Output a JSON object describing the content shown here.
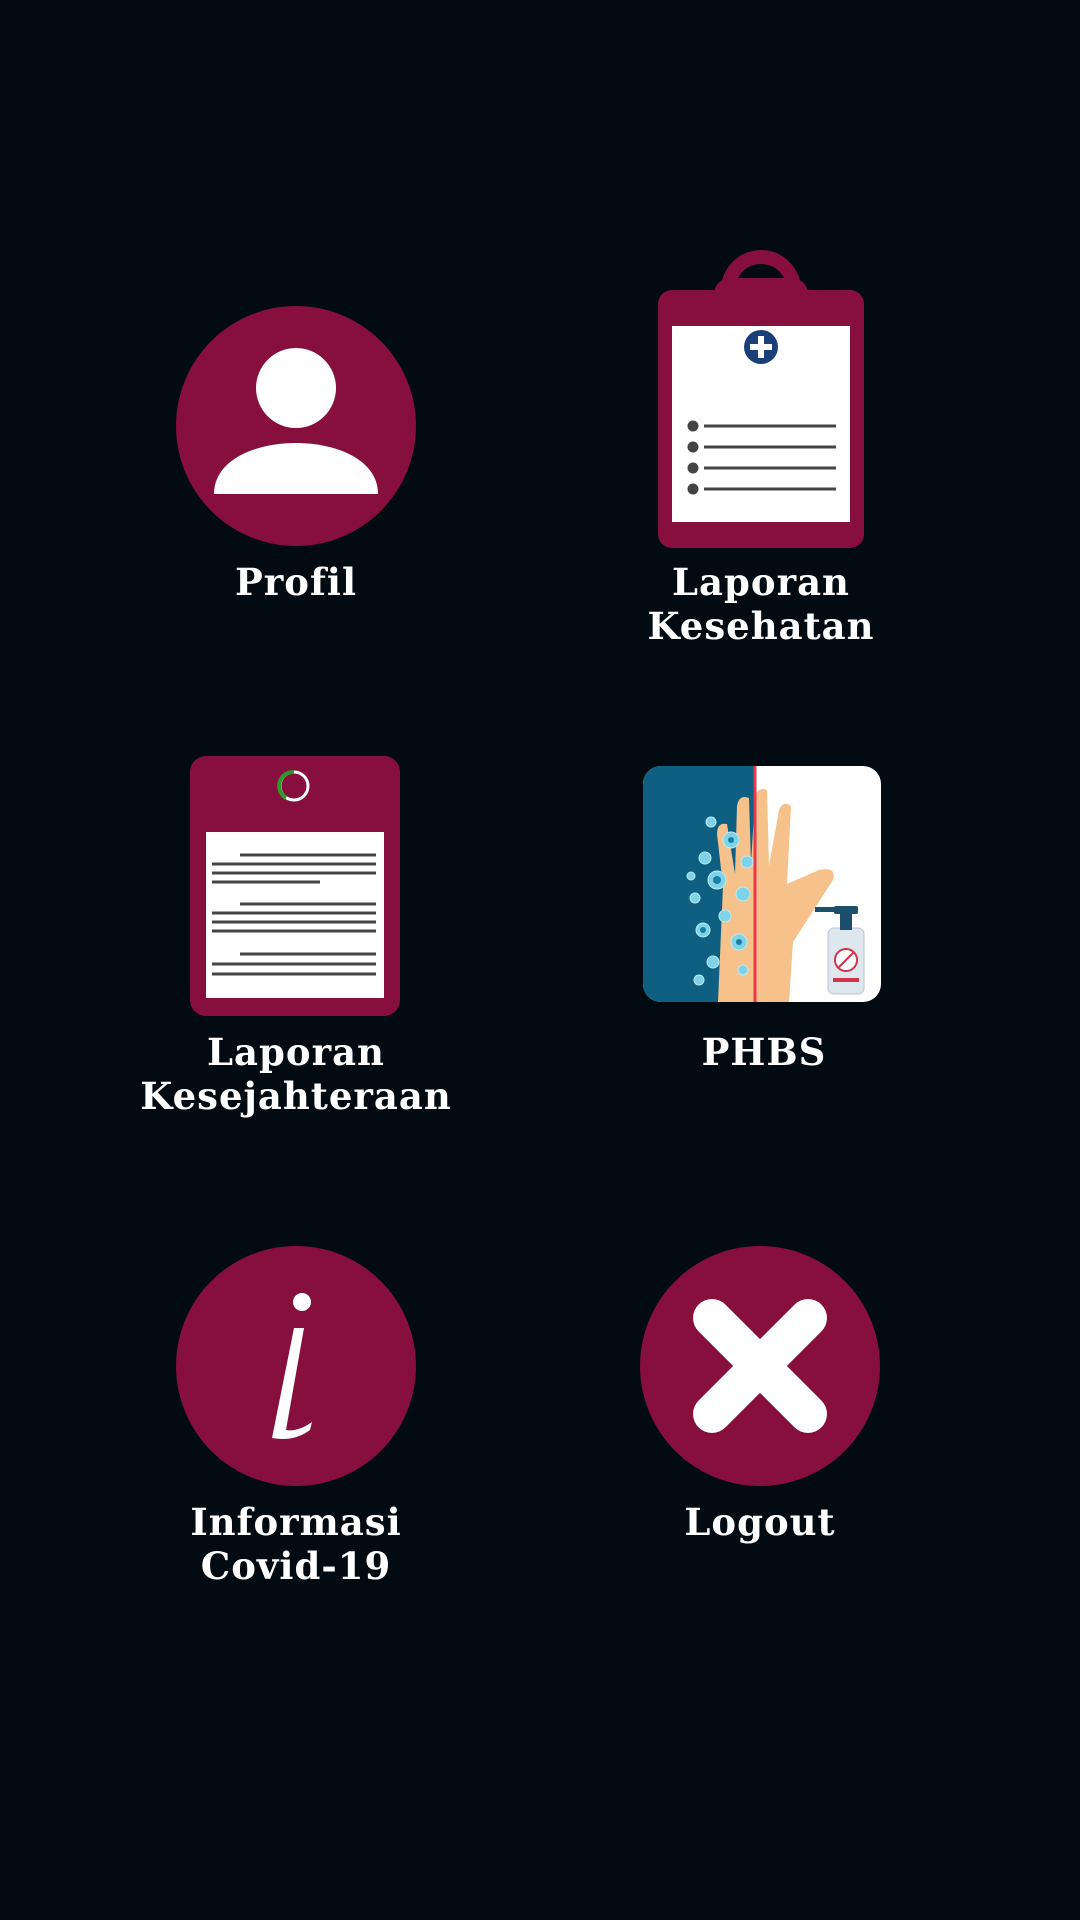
{
  "colors": {
    "background": "#020a12",
    "accent": "#860f3d",
    "text": "#ffffff"
  },
  "menu": {
    "profil": {
      "icon": "user-avatar-icon",
      "label": [
        "Profil"
      ]
    },
    "laporan_kesehatan": {
      "icon": "medical-clipboard-icon",
      "label": [
        "Laporan",
        "Kesehatan"
      ]
    },
    "laporan_kesejahteraan": {
      "icon": "report-document-icon",
      "label": [
        "Laporan",
        "Kesejahteraan"
      ]
    },
    "phbs": {
      "icon": "hand-sanitizer-illustration",
      "label": [
        "PHBS"
      ]
    },
    "informasi_covid": {
      "icon": "info-icon",
      "label": [
        "Informasi",
        "Covid-19"
      ]
    },
    "logout": {
      "icon": "close-x-icon",
      "label": [
        "Logout"
      ]
    }
  }
}
